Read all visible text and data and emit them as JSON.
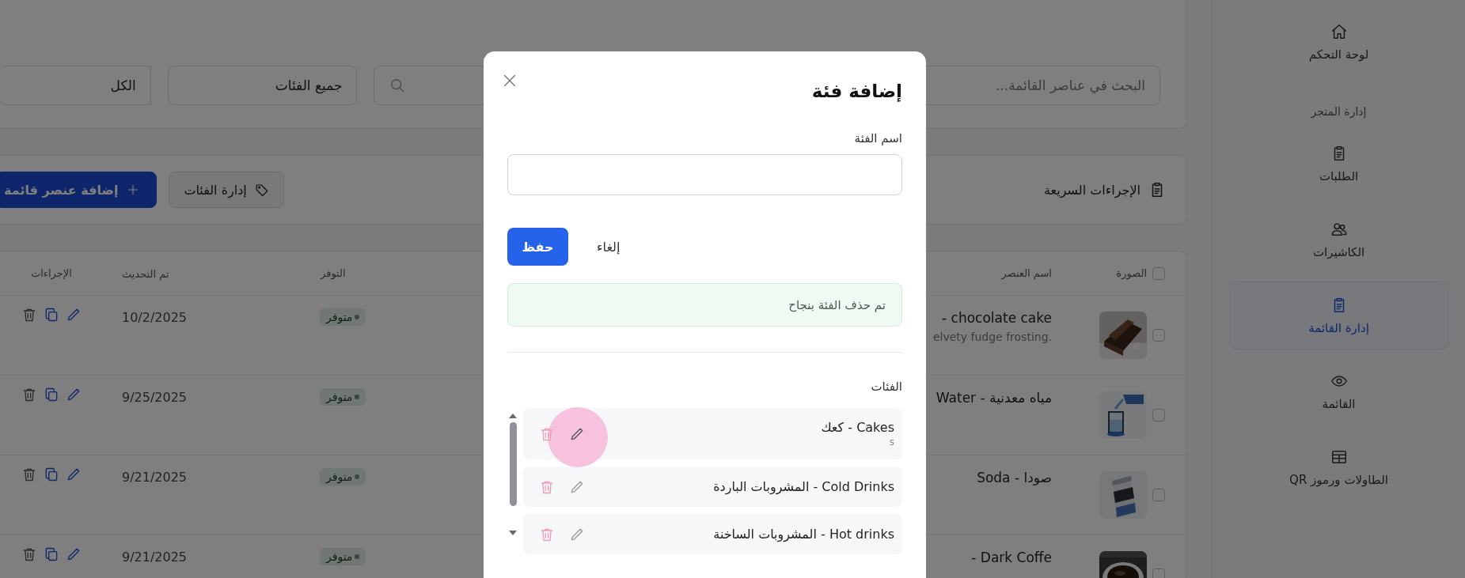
{
  "sidebar": {
    "items": [
      {
        "kind": "link",
        "label": "لوحة التحكم",
        "selected": false
      },
      {
        "kind": "section",
        "label": "إدارة المتجر",
        "selected": false
      },
      {
        "kind": "link",
        "label": "الطلبات",
        "selected": false
      },
      {
        "kind": "link",
        "label": "الكاشيرات",
        "selected": false
      },
      {
        "kind": "link",
        "label": "إدارة القائمة",
        "selected": true
      },
      {
        "kind": "link",
        "label": "القائمة",
        "selected": false
      },
      {
        "kind": "link",
        "label": "الطاولات ورموز QR",
        "selected": false
      }
    ]
  },
  "filters": {
    "search": {
      "placeholder": "البحث في عناصر القائمة..."
    },
    "category": {
      "value": "جميع الفئات"
    },
    "status": {
      "value": "الكل"
    }
  },
  "quick_actions": {
    "title": "الإجراءات السريعة",
    "buttons": [
      {
        "kind": "secondary",
        "label": "إدارة الفئات"
      },
      {
        "kind": "primary",
        "label": "إضافة عنصر قائمة"
      }
    ]
  },
  "table": {
    "select_all": {
      "checked": false
    },
    "columns": [
      "الصورة",
      "اسم العنصر",
      "التوفر",
      "تم التحديث",
      "الإجراءات"
    ],
    "rows": [
      {
        "checked": false,
        "name": "- chocolate cake",
        "description": "elvety fudge frosting.",
        "availability": "متوفر",
        "updated": "10/2/2025"
      },
      {
        "checked": false,
        "name": "Water - مياه معدنية",
        "availability": "متوفر",
        "updated": "9/25/2025"
      },
      {
        "checked": false,
        "name": "Soda - صودا",
        "availability": "متوفر",
        "updated": "9/21/2025"
      },
      {
        "checked": false,
        "name": "- Dark Coffe",
        "availability": "متوفر",
        "updated": "9/21/2025"
      }
    ]
  },
  "modal": {
    "title": "إضافة فئة",
    "field": {
      "label": "اسم الفئة"
    },
    "buttons": [
      {
        "kind": "secondary",
        "label": "إلغاء"
      },
      {
        "kind": "primary",
        "label": "حفظ"
      }
    ],
    "alert": "تم حذف الفئة بنجاح",
    "categories_heading": "الفئات",
    "categories": [
      {
        "name": "Cakes - كعك",
        "description": "s",
        "hovered": true
      },
      {
        "name": "Cold Drinks - المشروبات الباردة",
        "hovered": false
      },
      {
        "name": "Hot drinks - المشروبات الساخنة",
        "hovered": false
      }
    ]
  }
}
